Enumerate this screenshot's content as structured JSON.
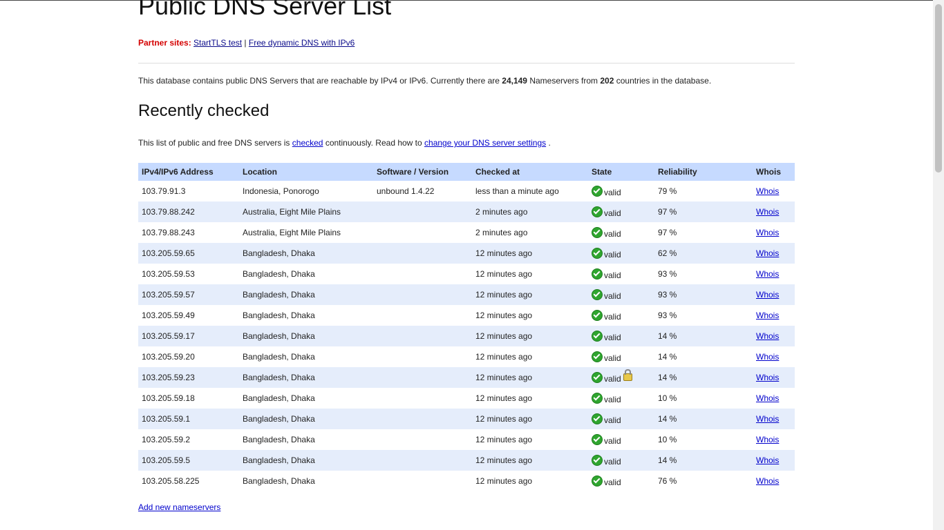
{
  "page": {
    "title": "Public DNS Server List",
    "partners_label": "Partner sites:",
    "partner_links": [
      "StartTLS test",
      "Free dynamic DNS with IPv6"
    ],
    "partner_separator": "|",
    "intro_pre": "This database contains public DNS Servers that are reachable by IPv4 or IPv6. Currently there are",
    "nameserver_count": "24,149",
    "intro_mid": "Nameservers from",
    "country_count": "202",
    "intro_post": "countries in the database.",
    "section_title": "Recently checked",
    "checked_pre": "This list of public and free DNS servers is",
    "checked_link": "checked",
    "checked_mid": "continuously. Read how to",
    "settings_link": "change your DNS server settings",
    "checked_post": ".",
    "add_link": "Add new nameservers"
  },
  "table": {
    "headers": [
      "IPv4/IPv6 Address",
      "Location",
      "Software / Version",
      "Checked at",
      "State",
      "Reliability",
      "Whois"
    ],
    "rows": [
      {
        "ip": "103.79.91.3",
        "location": "Indonesia, Ponorogo",
        "software": "unbound 1.4.22",
        "checked": "less than a minute ago",
        "state": "valid",
        "dnssec": false,
        "reliability": "79 %",
        "whois": "Whois"
      },
      {
        "ip": "103.79.88.242",
        "location": "Australia, Eight Mile Plains",
        "software": "",
        "checked": "2 minutes ago",
        "state": "valid",
        "dnssec": false,
        "reliability": "97 %",
        "whois": "Whois"
      },
      {
        "ip": "103.79.88.243",
        "location": "Australia, Eight Mile Plains",
        "software": "",
        "checked": "2 minutes ago",
        "state": "valid",
        "dnssec": false,
        "reliability": "97 %",
        "whois": "Whois"
      },
      {
        "ip": "103.205.59.65",
        "location": "Bangladesh, Dhaka",
        "software": "",
        "checked": "12 minutes ago",
        "state": "valid",
        "dnssec": false,
        "reliability": "62 %",
        "whois": "Whois"
      },
      {
        "ip": "103.205.59.53",
        "location": "Bangladesh, Dhaka",
        "software": "",
        "checked": "12 minutes ago",
        "state": "valid",
        "dnssec": false,
        "reliability": "93 %",
        "whois": "Whois"
      },
      {
        "ip": "103.205.59.57",
        "location": "Bangladesh, Dhaka",
        "software": "",
        "checked": "12 minutes ago",
        "state": "valid",
        "dnssec": false,
        "reliability": "93 %",
        "whois": "Whois"
      },
      {
        "ip": "103.205.59.49",
        "location": "Bangladesh, Dhaka",
        "software": "",
        "checked": "12 minutes ago",
        "state": "valid",
        "dnssec": false,
        "reliability": "93 %",
        "whois": "Whois"
      },
      {
        "ip": "103.205.59.17",
        "location": "Bangladesh, Dhaka",
        "software": "",
        "checked": "12 minutes ago",
        "state": "valid",
        "dnssec": false,
        "reliability": "14 %",
        "whois": "Whois"
      },
      {
        "ip": "103.205.59.20",
        "location": "Bangladesh, Dhaka",
        "software": "",
        "checked": "12 minutes ago",
        "state": "valid",
        "dnssec": false,
        "reliability": "14 %",
        "whois": "Whois"
      },
      {
        "ip": "103.205.59.23",
        "location": "Bangladesh, Dhaka",
        "software": "",
        "checked": "12 minutes ago",
        "state": "valid",
        "dnssec": true,
        "reliability": "14 %",
        "whois": "Whois"
      },
      {
        "ip": "103.205.59.18",
        "location": "Bangladesh, Dhaka",
        "software": "",
        "checked": "12 minutes ago",
        "state": "valid",
        "dnssec": false,
        "reliability": "10 %",
        "whois": "Whois"
      },
      {
        "ip": "103.205.59.1",
        "location": "Bangladesh, Dhaka",
        "software": "",
        "checked": "12 minutes ago",
        "state": "valid",
        "dnssec": false,
        "reliability": "14 %",
        "whois": "Whois"
      },
      {
        "ip": "103.205.59.2",
        "location": "Bangladesh, Dhaka",
        "software": "",
        "checked": "12 minutes ago",
        "state": "valid",
        "dnssec": false,
        "reliability": "10 %",
        "whois": "Whois"
      },
      {
        "ip": "103.205.59.5",
        "location": "Bangladesh, Dhaka",
        "software": "",
        "checked": "12 minutes ago",
        "state": "valid",
        "dnssec": false,
        "reliability": "14 %",
        "whois": "Whois"
      },
      {
        "ip": "103.205.58.225",
        "location": "Bangladesh, Dhaka",
        "software": "",
        "checked": "12 minutes ago",
        "state": "valid",
        "dnssec": false,
        "reliability": "76 %",
        "whois": "Whois"
      }
    ]
  },
  "colors": {
    "header_bg": "#c6daff",
    "alt_row_bg": "#e5edfb",
    "partner_label": "#d40000",
    "valid_icon": "#2fa52f"
  },
  "icons": {
    "valid": "check-circle-icon",
    "dnssec": "lock-icon"
  }
}
